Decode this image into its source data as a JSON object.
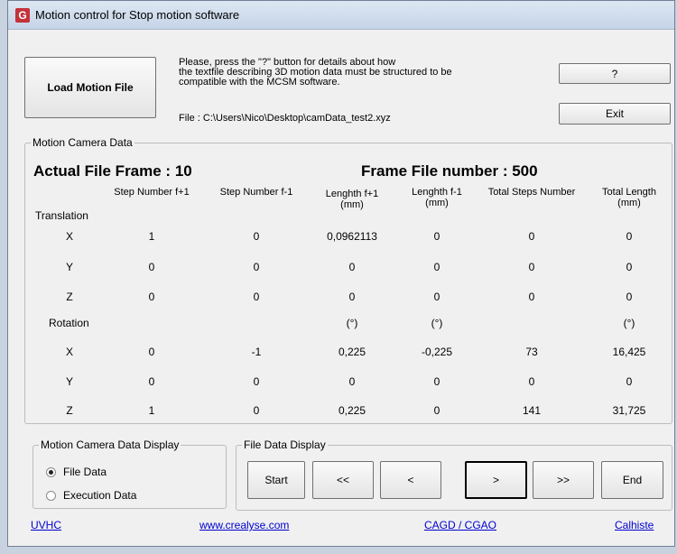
{
  "window": {
    "title": "Motion control for Stop motion software",
    "icon_letter": "G"
  },
  "top": {
    "load_button": "Load Motion File",
    "info_lines": [
      "Please, press the \"?\" button for details about how",
      " the textfile describing 3D motion data must be structured to be",
      "compatible with the MCSM software."
    ],
    "file_line": "File : C:\\Users\\Nico\\Desktop\\camData_test2.xyz",
    "help_button": "?",
    "exit_button": "Exit"
  },
  "data_group": {
    "label": "Motion Camera Data",
    "actual_frame": "Actual File Frame : 10",
    "frame_number": "Frame File number : 500",
    "columns": [
      {
        "line1": "Step Number f+1",
        "line2": ""
      },
      {
        "line1": "Step Number f-1",
        "line2": ""
      },
      {
        "line1": "Lenghth  f+1",
        "line2": "(mm)"
      },
      {
        "line1": "Lenghth f-1",
        "line2": "(mm)"
      },
      {
        "line1": "Total Steps Number",
        "line2": ""
      },
      {
        "line1": "Total  Length",
        "line2": "(mm)"
      }
    ],
    "translation_label": "Translation",
    "translation_rows": [
      {
        "axis": "X",
        "values": [
          "1",
          "0",
          "0,0962113",
          "0",
          "0",
          "0"
        ]
      },
      {
        "axis": "Y",
        "values": [
          "0",
          "0",
          "0",
          "0",
          "0",
          "0"
        ]
      },
      {
        "axis": "Z",
        "values": [
          "0",
          "0",
          "0",
          "0",
          "0",
          "0"
        ]
      }
    ],
    "rotation_label": "Rotation",
    "rotation_units": [
      "",
      "",
      "(°)",
      "(°)",
      "",
      "(°)"
    ],
    "rotation_rows": [
      {
        "axis": "X",
        "values": [
          "0",
          "-1",
          "0,225",
          "-0,225",
          "73",
          "16,425"
        ]
      },
      {
        "axis": "Y",
        "values": [
          "0",
          "0",
          "0",
          "0",
          "0",
          "0"
        ]
      },
      {
        "axis": "Z",
        "values": [
          "1",
          "0",
          "0,225",
          "0",
          "141",
          "31,725"
        ]
      }
    ]
  },
  "display_group": {
    "label": "Motion Camera Data Display",
    "options": [
      {
        "label": "File Data",
        "checked": true
      },
      {
        "label": "Execution Data",
        "checked": false
      }
    ]
  },
  "file_display": {
    "label": "File Data Display",
    "buttons": [
      "Start",
      "<<",
      "<",
      ">",
      ">>",
      "End"
    ]
  },
  "footer_links": [
    "UVHC",
    "www.crealyse.com",
    "CAGD / CGAO",
    "Calhiste"
  ]
}
